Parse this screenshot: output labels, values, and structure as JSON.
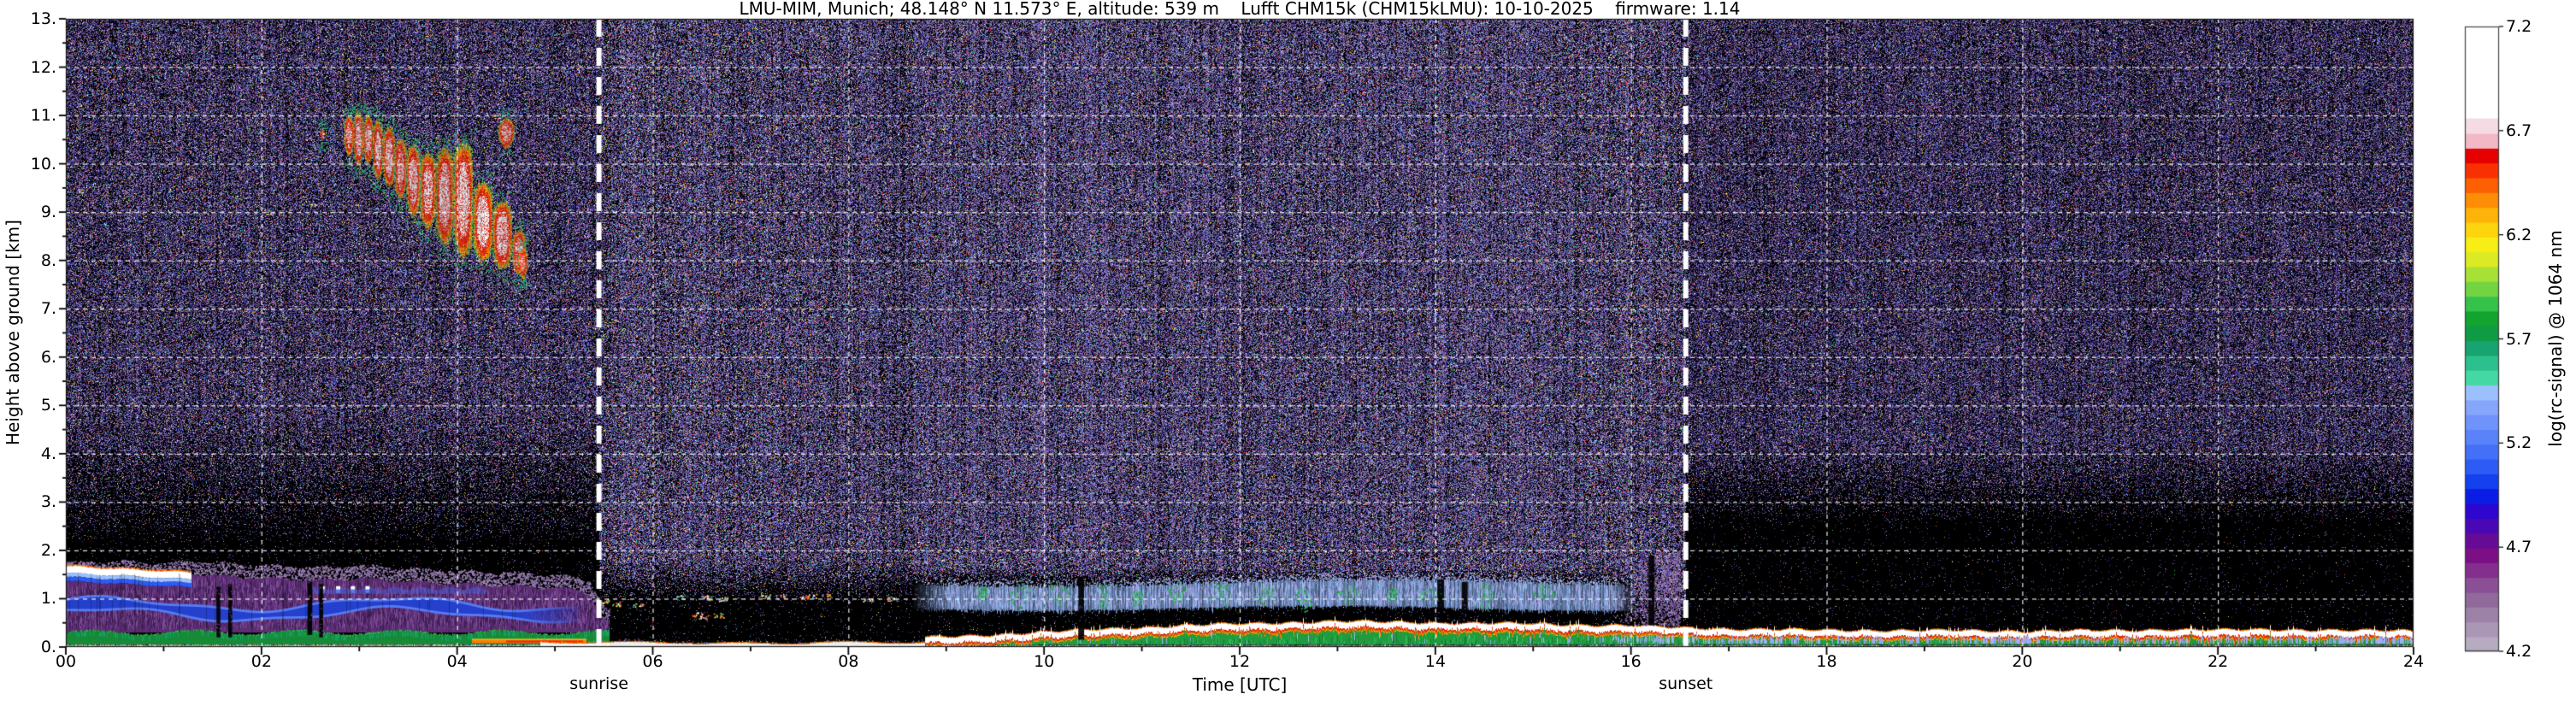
{
  "title": "LMU-MIM, Munich; 48.148° N 11.573° E, altitude: 539 m    Lufft CHM15k (CHM15kLMU): 10-10-2025    firmware: 1.14",
  "axes": {
    "ylabel": "Height above ground [km]",
    "xlabel": "Time [UTC]",
    "yticks": [
      "0.",
      "1.",
      "2.",
      "3.",
      "4.",
      "5.",
      "6.",
      "7.",
      "8.",
      "9.",
      "10.",
      "11.",
      "12.",
      "13."
    ],
    "xticks": [
      "00",
      "02",
      "04",
      "06",
      "08",
      "10",
      "12",
      "14",
      "16",
      "18",
      "20",
      "22",
      "24"
    ]
  },
  "annotations": {
    "sunrise": {
      "label": "sunrise",
      "time": 5.45
    },
    "sunset": {
      "label": "sunset",
      "time": 16.56
    }
  },
  "colorbar": {
    "label": "log(rc-signal) @ 1064 nm",
    "tick_labels": [
      "7.2",
      "6.7",
      "6.2",
      "5.7",
      "5.2",
      "4.7",
      "4.2"
    ],
    "min": 4.2,
    "max": 7.2,
    "white_fraction": 0.147,
    "colors": [
      "#b6abc0",
      "#aa97b5",
      "#9d82a8",
      "#8f6a9b",
      "#8a4f95",
      "#842f8d",
      "#7c0f86",
      "#650b96",
      "#4a07b5",
      "#2d06cf",
      "#0b1ce5",
      "#1440ee",
      "#2c5bf5",
      "#4470f8",
      "#5a82fa",
      "#7093fb",
      "#86a6fc",
      "#9cc0fd",
      "#44d9a4",
      "#2cc08e",
      "#17a470",
      "#0f9a44",
      "#12a42e",
      "#35c24b",
      "#72d442",
      "#a8e135",
      "#dcea24",
      "#f6ee14",
      "#fdd40e",
      "#fdb309",
      "#fd8d05",
      "#fd5f03",
      "#f93102",
      "#e60000",
      "#f2b8c6",
      "#f5dbe3"
    ]
  },
  "chart_data": {
    "type": "heatmap",
    "x_range_hours": [
      0,
      24
    ],
    "y_range_km": [
      0,
      13
    ],
    "signal_range": [
      4.2,
      7.2
    ],
    "grid": {
      "x_step_hours": 2,
      "y_step_km": 1,
      "style": "white-dashed"
    },
    "noise": {
      "purples": [
        "#5d4585",
        "#473269",
        "#8a6fa6",
        "#a98fc0",
        "#332052"
      ],
      "blues": [
        "#4253cf",
        "#2b379f",
        "#7d8fe8",
        "#5f7df0"
      ],
      "brights": [
        "#ffffff",
        "#45c86a",
        "#ff5050",
        "#f0e24a",
        "#45c9c9",
        "#f08030",
        "#c550c5",
        "#9fb3ff"
      ],
      "graycast": "#9a93bd",
      "regions": [
        {
          "t0": 0,
          "t1": 5.45,
          "fadeLo": 1.95,
          "fadeHi": 4.85,
          "dmax": 0.62
        },
        {
          "t0": 5.45,
          "t1": 8.65,
          "fadeLo": 0.9,
          "fadeHi": 1.8,
          "dmax": 0.66
        },
        {
          "t0": 8.65,
          "t1": 16.0,
          "fadeLo": 1.28,
          "fadeHi": 1.63,
          "dmax": 0.7
        },
        {
          "t0": 16.0,
          "t1": 16.56,
          "fadeLo": 0.42,
          "fadeHi": 1.2,
          "dmax": 0.66
        },
        {
          "t0": 16.56,
          "t1": 24.01,
          "fadeLo": 2.5,
          "fadeHi": 4.2,
          "dmax": 0.6
        }
      ]
    },
    "morning_aerosol": {
      "t_end": 5.55,
      "white_cap": {
        "t_end": 1.28,
        "top0": 1.67,
        "slope": 0.1,
        "thick": 0.14
      },
      "purple_top": [
        [
          0,
          1.47
        ],
        [
          0.5,
          1.5
        ],
        [
          1,
          1.46
        ],
        [
          1.3,
          1.52
        ],
        [
          1.7,
          1.45
        ],
        [
          2,
          1.43
        ],
        [
          2.3,
          1.4
        ],
        [
          2.6,
          1.37
        ],
        [
          3,
          1.42
        ],
        [
          3.3,
          1.38
        ],
        [
          3.6,
          1.34
        ],
        [
          4,
          1.3
        ],
        [
          4.3,
          1.28
        ],
        [
          4.6,
          1.26
        ],
        [
          5,
          1.22
        ],
        [
          5.2,
          1.18
        ],
        [
          5.35,
          1.1
        ],
        [
          5.5,
          0.55
        ]
      ],
      "blue_band": {
        "center": 0.78,
        "amp": 0.13,
        "freq": 2.1,
        "phase": 0.8,
        "hw": 0.13,
        "t_end": 5.25
      },
      "green_top": 0.3,
      "hot_strip": {
        "t0": 4.15,
        "t1": 5.32,
        "lo": 0.08,
        "hi": 0.17
      },
      "spikes": [
        2.62,
        2.78,
        2.93,
        3.08
      ]
    },
    "ground_strip": {
      "t0": 4.85,
      "t1": 8.78,
      "h": 0.09
    },
    "boundary_layer": {
      "top_profile_km": [
        [
          5.4,
          0.1
        ],
        [
          6,
          0.1
        ],
        [
          7,
          0.12
        ],
        [
          8,
          0.14
        ],
        [
          8.6,
          0.17
        ],
        [
          9,
          0.2
        ],
        [
          9.5,
          0.25
        ],
        [
          10,
          0.3
        ],
        [
          10.5,
          0.35
        ],
        [
          11,
          0.4
        ],
        [
          11.5,
          0.44
        ],
        [
          12,
          0.47
        ],
        [
          12.5,
          0.5
        ],
        [
          13,
          0.52
        ],
        [
          13.5,
          0.51
        ],
        [
          14,
          0.5
        ],
        [
          14.5,
          0.48
        ],
        [
          15,
          0.47
        ],
        [
          15.5,
          0.45
        ],
        [
          16,
          0.43
        ],
        [
          16.5,
          0.39
        ],
        [
          17,
          0.37
        ],
        [
          17.5,
          0.35
        ],
        [
          18,
          0.34
        ],
        [
          18.5,
          0.34
        ],
        [
          19,
          0.33
        ],
        [
          19.5,
          0.33
        ],
        [
          20,
          0.32
        ],
        [
          20.5,
          0.33
        ],
        [
          21,
          0.33
        ],
        [
          21.5,
          0.36
        ],
        [
          22,
          0.34
        ],
        [
          22.5,
          0.35
        ],
        [
          23,
          0.35
        ],
        [
          23.5,
          0.33
        ],
        [
          24,
          0.32
        ]
      ],
      "red_tongue_ranges": [
        [
          12,
          15.6
        ],
        [
          20.8,
          23.8
        ]
      ],
      "blue_patch_ranges": [
        [
          16.05,
          16.45
        ],
        [
          17.0,
          17.5
        ],
        [
          19.6,
          20.1
        ],
        [
          23.2,
          24
        ]
      ]
    },
    "elevated_haze": {
      "t0": 8.65,
      "t1": 16.05,
      "bottom": 0.8,
      "top": 1.33,
      "green_blobs": [
        9.35,
        9.75,
        10.15,
        10.6,
        10.95,
        11.35,
        11.8,
        12.25,
        12.65,
        13.1,
        13.55,
        13.95,
        14.5,
        15.1
      ]
    },
    "presunset_purple": {
      "t0": 15.55,
      "t1": 16.5,
      "k0": 0.45,
      "k1": 1.95
    },
    "dark_streaks": [
      [
        1.54,
        1.58,
        0.2,
        1.25
      ],
      [
        1.66,
        1.7,
        0.2,
        1.3
      ],
      [
        2.47,
        2.52,
        0.25,
        1.35
      ],
      [
        2.59,
        2.63,
        0.2,
        1.3
      ],
      [
        10.35,
        10.41,
        0.15,
        1.45
      ],
      [
        14.02,
        14.09,
        0.5,
        1.4
      ],
      [
        14.27,
        14.33,
        0.5,
        1.35
      ],
      [
        16.18,
        16.24,
        0.45,
        1.9
      ]
    ],
    "cloud": {
      "lobes": [
        [
          2.58,
          2.66,
          10.72,
          10.5,
          0.5
        ],
        [
          2.84,
          2.94,
          11.02,
          10.15,
          0.75
        ],
        [
          2.94,
          3.04,
          11.08,
          9.95,
          0.9
        ],
        [
          3.04,
          3.14,
          11.02,
          10.0,
          0.85
        ],
        [
          3.14,
          3.24,
          10.92,
          9.65,
          0.9
        ],
        [
          3.24,
          3.36,
          10.78,
          9.5,
          0.85
        ],
        [
          3.36,
          3.48,
          10.55,
          9.25,
          0.8
        ],
        [
          3.48,
          3.62,
          10.42,
          8.9,
          0.85
        ],
        [
          3.62,
          3.78,
          10.25,
          8.65,
          0.8
        ],
        [
          3.78,
          3.96,
          10.35,
          8.3,
          0.95
        ],
        [
          3.96,
          4.16,
          10.45,
          8.05,
          0.95
        ],
        [
          4.16,
          4.36,
          9.65,
          7.95,
          1.0
        ],
        [
          4.36,
          4.56,
          9.25,
          7.8,
          0.9
        ],
        [
          4.56,
          4.7,
          8.65,
          7.7,
          0.7
        ],
        [
          4.42,
          4.58,
          10.95,
          10.3,
          0.6
        ],
        [
          4.62,
          4.72,
          8.25,
          7.62,
          0.5
        ]
      ],
      "specks": [
        [
          1.76,
          9.3
        ],
        [
          2.06,
          9.0
        ],
        [
          2.53,
          9.15
        ],
        [
          0.15,
          9.45
        ]
      ]
    },
    "morning_specks_1km": [
      [
        5.5,
        0.95
      ],
      [
        5.62,
        0.9
      ],
      [
        5.85,
        0.87
      ],
      [
        6.28,
        1.04
      ],
      [
        6.45,
        0.68
      ],
      [
        6.52,
        0.62
      ],
      [
        6.55,
        1.03
      ],
      [
        6.67,
        0.66
      ],
      [
        6.72,
        1.0
      ],
      [
        7.15,
        1.05
      ],
      [
        7.3,
        1.04
      ],
      [
        7.55,
        1.05
      ],
      [
        7.62,
        1.06
      ],
      [
        7.78,
        1.07
      ],
      [
        8.2,
        0.97
      ],
      [
        8.45,
        1.0
      ]
    ]
  }
}
